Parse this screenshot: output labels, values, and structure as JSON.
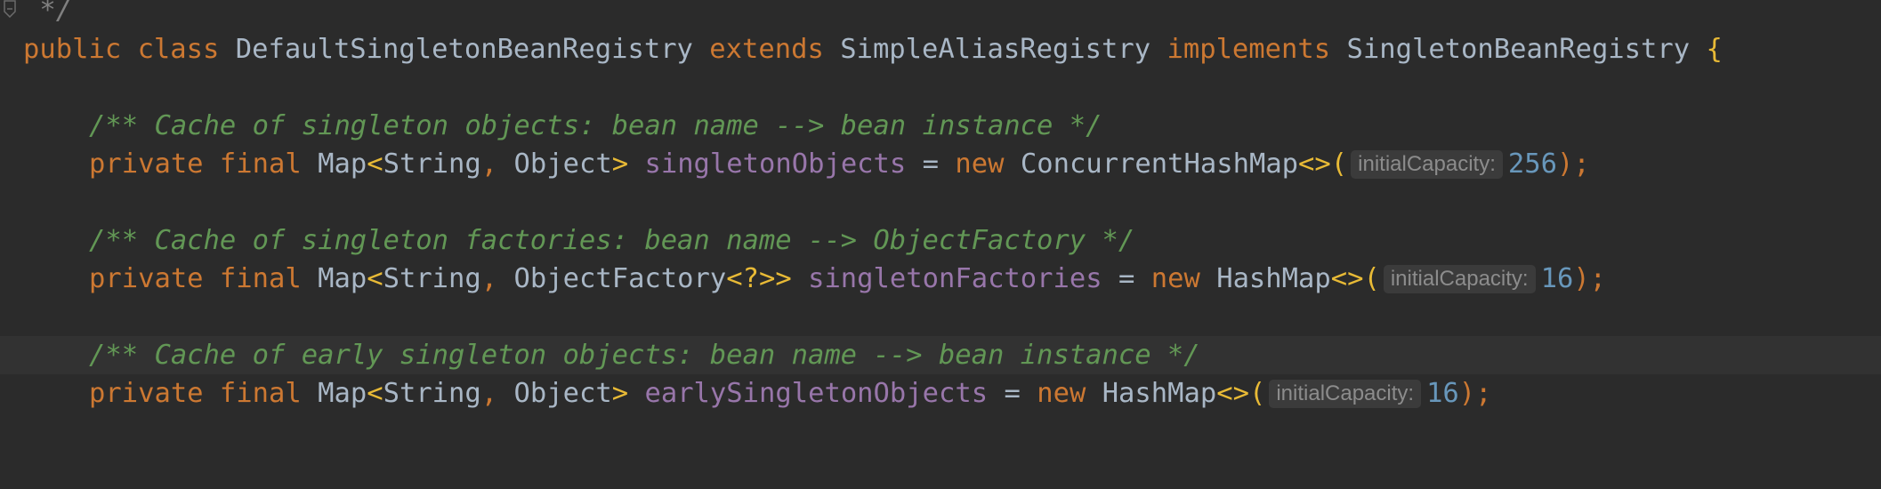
{
  "editor": {
    "language": "Java",
    "theme_colors": {
      "background": "#2b2b2b",
      "keyword": "#cc7832",
      "identifier": "#a9b7c6",
      "field": "#9876aa",
      "number": "#6897bb",
      "doc_comment": "#629755",
      "brace": "#e8ba36",
      "hint_background": "#3b3b3b",
      "hint_text": "#8c8c8c"
    },
    "gutter": {
      "fold_icon": "fold-end-icon"
    },
    "line0": {
      "comment_end": " */"
    },
    "line1": {
      "kw_public": "public",
      "kw_class": "class",
      "class_name": "DefaultSingletonBeanRegistry",
      "kw_extends": "extends",
      "super_class": "SimpleAliasRegistry",
      "kw_implements": "implements",
      "interface_name": "SingletonBeanRegistry",
      "open_brace": "{"
    },
    "line3": {
      "comment": "/** Cache of singleton objects: bean name --> bean instance */"
    },
    "line4": {
      "kw_private": "private",
      "kw_final": "final",
      "type_map": "Map",
      "lt": "<",
      "type_string": "String",
      "comma": ",",
      "type_value": "Object",
      "gt": ">",
      "field_name": "singletonObjects",
      "equals": "=",
      "kw_new": "new",
      "ctor": "ConcurrentHashMap",
      "diamond": "<>(",
      "hint": "initialCapacity:",
      "arg": "256",
      "close": ");"
    },
    "line6": {
      "comment": "/** Cache of singleton factories: bean name --> ObjectFactory */"
    },
    "line7": {
      "kw_private": "private",
      "kw_final": "final",
      "type_map": "Map",
      "lt": "<",
      "type_string": "String",
      "comma": ",",
      "type_value": "ObjectFactory",
      "wildcard": "<?>>",
      "field_name": "singletonFactories",
      "equals": "=",
      "kw_new": "new",
      "ctor": "HashMap",
      "diamond": "<>(",
      "hint": "initialCapacity:",
      "arg": "16",
      "close": ");"
    },
    "line9": {
      "comment": "/** Cache of early singleton objects: bean name --> bean instance */"
    },
    "line10": {
      "kw_private": "private",
      "kw_final": "final",
      "type_map": "Map",
      "lt": "<",
      "type_string": "String",
      "comma": ",",
      "type_value": "Object",
      "gt": ">",
      "field_name": "earlySingletonObjects",
      "equals": "=",
      "kw_new": "new",
      "ctor": "HashMap",
      "diamond": "<>(",
      "hint": "initialCapacity:",
      "arg": "16",
      "close": ");"
    }
  }
}
